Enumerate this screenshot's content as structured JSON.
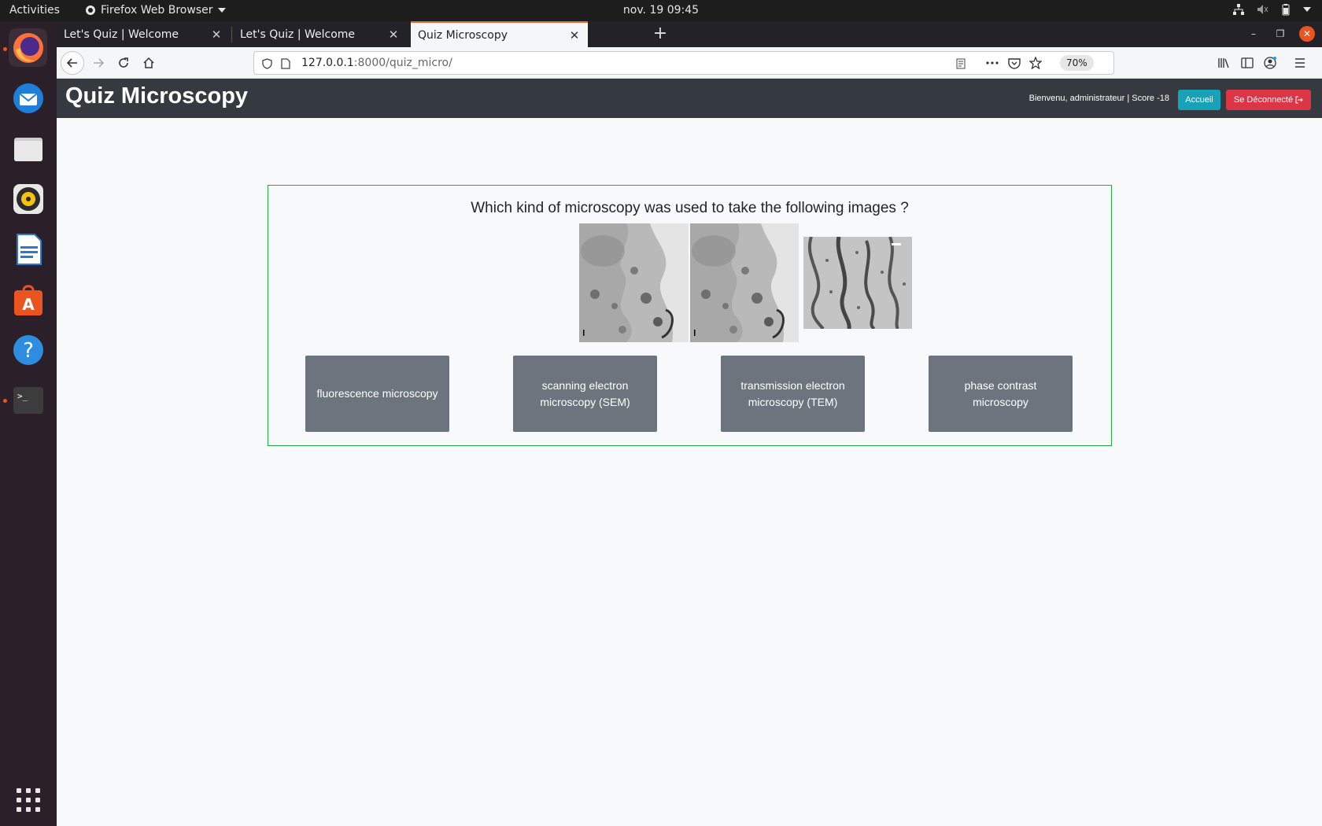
{
  "topbar": {
    "activities": "Activities",
    "app_name": "Firefox Web Browser",
    "clock": "nov. 19  09:45"
  },
  "dock": {
    "items": [
      "firefox-icon",
      "thunderbird-icon",
      "files-icon",
      "rhythmbox-icon",
      "writer-icon",
      "software-icon",
      "help-icon",
      "terminal-icon",
      "show-apps-icon"
    ]
  },
  "browser": {
    "tabs": [
      {
        "label": "Let's Quiz | Welcome"
      },
      {
        "label": "Let's Quiz | Welcome"
      },
      {
        "label": "Quiz Microscopy"
      }
    ],
    "url_host": "127.0.0.1",
    "url_rest": ":8000/quiz_micro/",
    "zoom": "70%"
  },
  "site": {
    "title": "Quiz Microscopy",
    "welcome": "Bienvenu, administrateur | Score -18",
    "home_button": "Accueil",
    "logout_button": "Se Déconnecté"
  },
  "quiz": {
    "question": "Which kind of microscopy was used to take the following images ?",
    "answers": [
      "fluorescence microscopy",
      "scanning electron microscopy (SEM)",
      "transmission electron microscopy (TEM)",
      "phase contrast microscopy"
    ]
  },
  "colors": {
    "navbar": "#343a40",
    "accueil": "#17a2b8",
    "logout": "#dc3545",
    "answer": "#6c757d",
    "quiz_border": "#28a745"
  }
}
